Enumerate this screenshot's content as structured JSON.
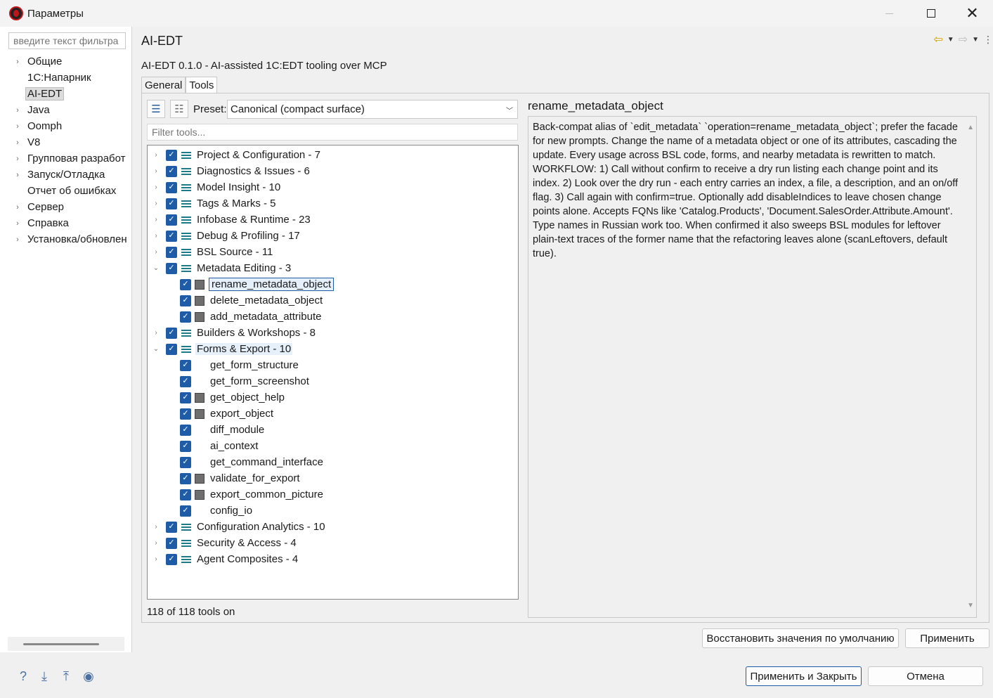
{
  "window": {
    "title": "Параметры",
    "controls": [
      "minimize",
      "maximize",
      "close"
    ]
  },
  "left": {
    "filter_placeholder": "введите текст фильтра",
    "items": [
      {
        "label": "Общие",
        "expandable": true
      },
      {
        "label": "1С:Напарник",
        "expandable": false
      },
      {
        "label": "AI-EDT",
        "expandable": false,
        "selected": true
      },
      {
        "label": "Java",
        "expandable": true
      },
      {
        "label": "Oomph",
        "expandable": true
      },
      {
        "label": "V8",
        "expandable": true
      },
      {
        "label": "Групповая разработ",
        "expandable": true
      },
      {
        "label": "Запуск/Отладка",
        "expandable": true
      },
      {
        "label": "Отчет  об ошибках",
        "expandable": false
      },
      {
        "label": "Сервер",
        "expandable": true
      },
      {
        "label": "Справка",
        "expandable": true
      },
      {
        "label": "Установка/обновлен",
        "expandable": true
      }
    ]
  },
  "page": {
    "title": "AI-EDT",
    "subtitle": "AI-EDT 0.1.0 - AI-assisted 1C:EDT tooling over MCP",
    "tabs": [
      {
        "label": "General",
        "active": false
      },
      {
        "label": "Tools",
        "active": true
      }
    ]
  },
  "tools": {
    "preset_label": "Preset:",
    "preset_value": "Canonical (compact surface)",
    "filter_placeholder": "Filter tools...",
    "count_text": "118 of 118 tools on",
    "tree": [
      {
        "label": "Project & Configuration - 7",
        "type": "group",
        "expanded": false
      },
      {
        "label": "Diagnostics & Issues - 6",
        "type": "group",
        "expanded": false
      },
      {
        "label": "Model Insight - 10",
        "type": "group",
        "expanded": false
      },
      {
        "label": "Tags & Marks - 5",
        "type": "group",
        "expanded": false
      },
      {
        "label": "Infobase & Runtime - 23",
        "type": "group",
        "expanded": false
      },
      {
        "label": "Debug & Profiling - 17",
        "type": "group",
        "expanded": false
      },
      {
        "label": "BSL Source - 11",
        "type": "group",
        "expanded": false
      },
      {
        "label": "Metadata Editing - 3",
        "type": "group",
        "expanded": true
      },
      {
        "label": "rename_metadata_object",
        "type": "tool",
        "icon": true,
        "selected": true
      },
      {
        "label": "delete_metadata_object",
        "type": "tool",
        "icon": true
      },
      {
        "label": "add_metadata_attribute",
        "type": "tool",
        "icon": true
      },
      {
        "label": "Builders & Workshops - 8",
        "type": "group",
        "expanded": false
      },
      {
        "label": "Forms & Export - 10",
        "type": "group",
        "expanded": true,
        "highlight": true
      },
      {
        "label": "get_form_structure",
        "type": "tool",
        "icon": false
      },
      {
        "label": "get_form_screenshot",
        "type": "tool",
        "icon": false
      },
      {
        "label": "get_object_help",
        "type": "tool",
        "icon": true
      },
      {
        "label": "export_object",
        "type": "tool",
        "icon": true
      },
      {
        "label": "diff_module",
        "type": "tool",
        "icon": false
      },
      {
        "label": "ai_context",
        "type": "tool",
        "icon": false
      },
      {
        "label": "get_command_interface",
        "type": "tool",
        "icon": false
      },
      {
        "label": "validate_for_export",
        "type": "tool",
        "icon": true
      },
      {
        "label": "export_common_picture",
        "type": "tool",
        "icon": true
      },
      {
        "label": "config_io",
        "type": "tool",
        "icon": false
      },
      {
        "label": "Configuration Analytics - 10",
        "type": "group",
        "expanded": false
      },
      {
        "label": "Security & Access - 4",
        "type": "group",
        "expanded": false
      },
      {
        "label": "Agent Composites - 4",
        "type": "group",
        "expanded": false
      }
    ]
  },
  "detail": {
    "title": "rename_metadata_object",
    "text": "Back-compat alias of `edit_metadata` `operation=rename_metadata_object`; prefer the facade for new prompts. Change the name of a metadata object or one of its attributes, cascading the update. Every usage across BSL code, forms, and nearby metadata is rewritten to match. WORKFLOW: 1) Call without confirm to receive a dry run listing each change point and its index. 2) Look over the dry run - each entry carries an index, a file, a description, and an on/off flag. 3) Call again with confirm=true. Optionally add disableIndices to leave chosen change points alone. Accepts FQNs like 'Catalog.Products', 'Document.SalesOrder.Attribute.Amount'. Type names in Russian work too. When confirmed it also sweeps BSL modules for leftover plain-text traces of the former name that the refactoring leaves alone (scanLeftovers, default true)."
  },
  "buttons": {
    "restore_defaults": "Восстановить значения по умолчанию",
    "apply": "Применить",
    "apply_close": "Применить и Закрыть",
    "cancel": "Отмена"
  },
  "bottom_icons": [
    "help-icon",
    "import-icon",
    "export-icon",
    "record-icon"
  ]
}
